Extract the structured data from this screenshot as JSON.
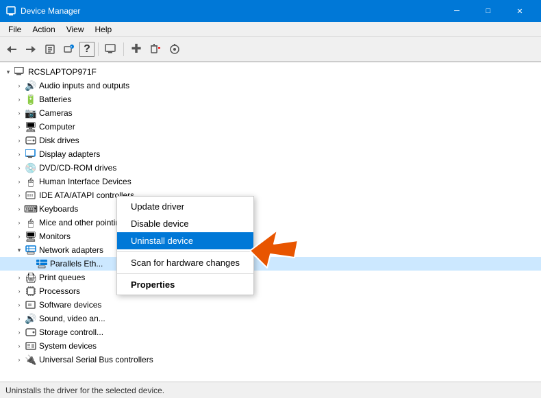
{
  "titleBar": {
    "title": "Device Manager",
    "icon": "⚙",
    "minimize": "─",
    "maximize": "□",
    "close": "✕"
  },
  "menuBar": {
    "items": [
      "File",
      "Action",
      "View",
      "Help"
    ]
  },
  "toolbar": {
    "buttons": [
      {
        "name": "back",
        "icon": "←"
      },
      {
        "name": "forward",
        "icon": "→"
      },
      {
        "name": "properties",
        "icon": "📋"
      },
      {
        "name": "update-driver",
        "icon": "🔄"
      },
      {
        "name": "help",
        "icon": "?"
      },
      {
        "name": "sep1",
        "type": "sep"
      },
      {
        "name": "monitor",
        "icon": "🖥"
      },
      {
        "name": "sep2",
        "type": "sep"
      },
      {
        "name": "add",
        "icon": "✚"
      },
      {
        "name": "remove",
        "icon": "✖"
      },
      {
        "name": "refresh",
        "icon": "⊕"
      }
    ]
  },
  "tree": {
    "root": {
      "label": "RCSLAPTOP971F",
      "icon": "💻",
      "expanded": true
    },
    "items": [
      {
        "label": "Audio inputs and outputs",
        "icon": "🔊",
        "indent": 1,
        "expanded": false
      },
      {
        "label": "Batteries",
        "icon": "🔋",
        "indent": 1,
        "expanded": false
      },
      {
        "label": "Cameras",
        "icon": "📷",
        "indent": 1,
        "expanded": false
      },
      {
        "label": "Computer",
        "icon": "🖥",
        "indent": 1,
        "expanded": false
      },
      {
        "label": "Disk drives",
        "icon": "💾",
        "indent": 1,
        "expanded": false
      },
      {
        "label": "Display adapters",
        "icon": "🖥",
        "indent": 1,
        "expanded": false
      },
      {
        "label": "DVD/CD-ROM drives",
        "icon": "💿",
        "indent": 1,
        "expanded": false
      },
      {
        "label": "Human Interface Devices",
        "icon": "🖱",
        "indent": 1,
        "expanded": false
      },
      {
        "label": "IDE ATA/ATAPI controllers",
        "icon": "💾",
        "indent": 1,
        "expanded": false
      },
      {
        "label": "Keyboards",
        "icon": "⌨",
        "indent": 1,
        "expanded": false
      },
      {
        "label": "Mice and other pointing devices",
        "icon": "🖱",
        "indent": 1,
        "expanded": false
      },
      {
        "label": "Monitors",
        "icon": "🖥",
        "indent": 1,
        "expanded": false
      },
      {
        "label": "Network adapters",
        "icon": "🌐",
        "indent": 1,
        "expanded": true
      },
      {
        "label": "Parallels Eth...",
        "icon": "🌐",
        "indent": 2,
        "expanded": false,
        "selected": true
      },
      {
        "label": "Print queues",
        "icon": "🖨",
        "indent": 1,
        "expanded": false
      },
      {
        "label": "Processors",
        "icon": "⚙",
        "indent": 1,
        "expanded": false
      },
      {
        "label": "Software devices",
        "icon": "📦",
        "indent": 1,
        "expanded": false
      },
      {
        "label": "Sound, video an...",
        "icon": "🔊",
        "indent": 1,
        "expanded": false
      },
      {
        "label": "Storage controll...",
        "icon": "💾",
        "indent": 1,
        "expanded": false
      },
      {
        "label": "System devices",
        "icon": "⚙",
        "indent": 1,
        "expanded": false
      },
      {
        "label": "Universal Serial Bus controllers",
        "icon": "🔌",
        "indent": 1,
        "expanded": false
      }
    ]
  },
  "contextMenu": {
    "items": [
      {
        "label": "Update driver",
        "type": "normal"
      },
      {
        "label": "Disable device",
        "type": "normal"
      },
      {
        "label": "Uninstall device",
        "type": "active"
      },
      {
        "label": "sep",
        "type": "sep"
      },
      {
        "label": "Scan for hardware changes",
        "type": "normal"
      },
      {
        "label": "sep2",
        "type": "sep"
      },
      {
        "label": "Properties",
        "type": "bold"
      }
    ]
  },
  "statusBar": {
    "text": "Uninstalls the driver for the selected device."
  }
}
